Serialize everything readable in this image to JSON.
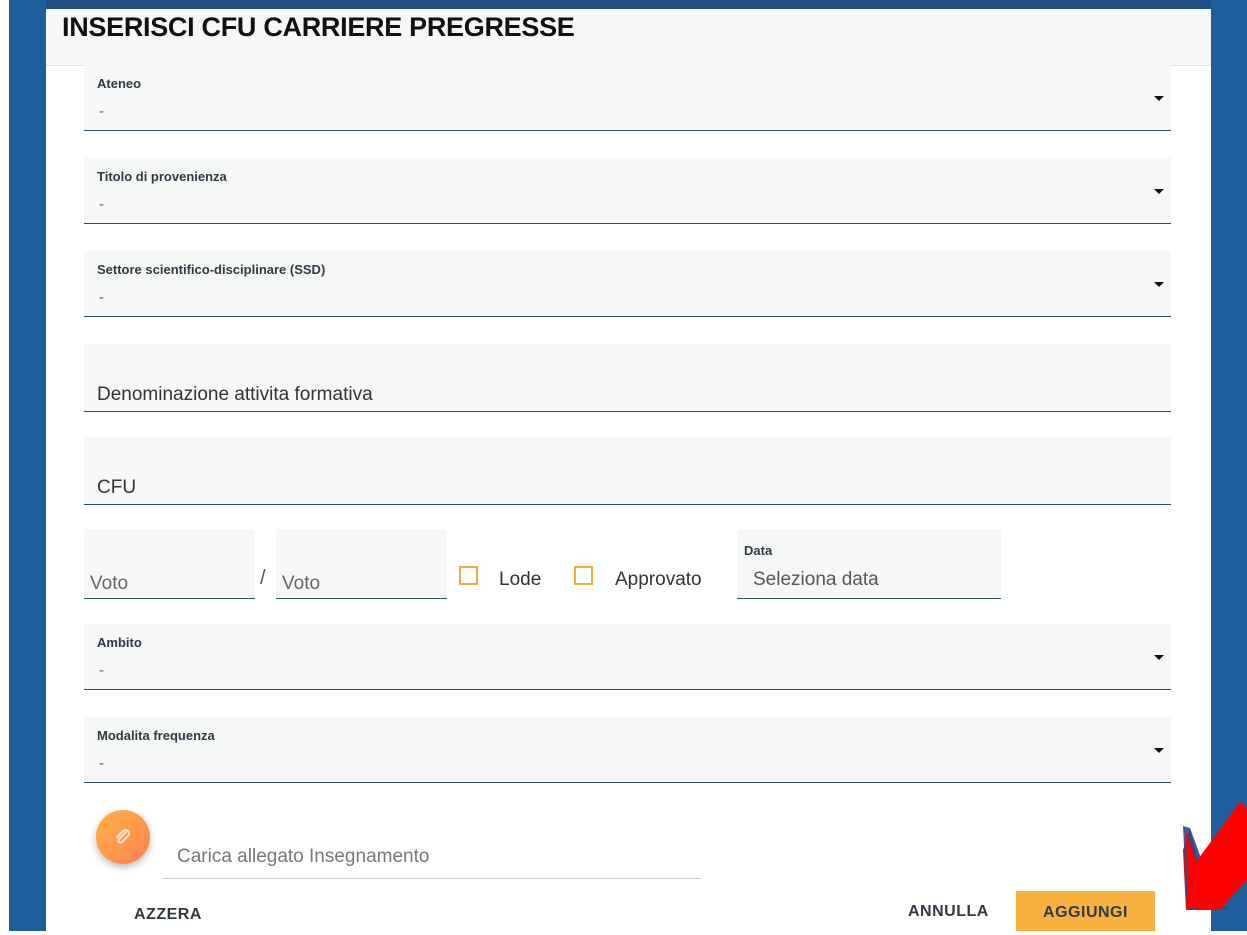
{
  "dialog": {
    "title": "INSERISCI CFU CARRIERE PREGRESSE"
  },
  "fields": {
    "ateneo": {
      "label": "Ateneo",
      "value": "-"
    },
    "titolo": {
      "label": "Titolo di provenienza",
      "value": "-"
    },
    "ssd": {
      "label": "Settore scientifico-disciplinare (SSD)",
      "value": "-"
    },
    "denominazione": {
      "placeholder": "Denominazione attivita formativa"
    },
    "cfu": {
      "placeholder": "CFU"
    },
    "voto": {
      "placeholder": "Voto"
    },
    "voto_max": {
      "placeholder": "Voto"
    },
    "separator": "/",
    "lode": {
      "label": "Lode",
      "checked": false
    },
    "approvato": {
      "label": "Approvato",
      "checked": false
    },
    "data": {
      "label": "Data",
      "placeholder": "Seleziona data"
    },
    "ambito": {
      "label": "Ambito",
      "value": "-"
    },
    "modalita": {
      "label": "Modalita frequenza",
      "value": "-"
    },
    "allegato": {
      "placeholder": "Carica allegato Insegnamento",
      "icon": "paperclip-icon"
    }
  },
  "actions": {
    "reset_label": "AZZERA",
    "cancel_label": "ANNULLA",
    "add_label": "AGGIUNGI"
  },
  "colors": {
    "accent": "#f7b13f",
    "backdrop": "#1d5f9b",
    "field_bg": "#f6f7f7",
    "annotation_arrow": "#ff0000"
  }
}
